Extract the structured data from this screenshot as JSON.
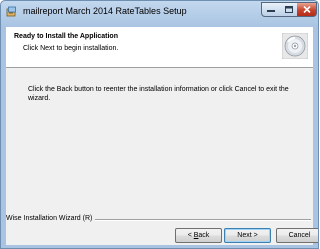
{
  "window": {
    "title": "mailreport March 2014 RateTables Setup",
    "minimize_glyph": "▁",
    "maximize_glyph": "□",
    "close_glyph": "✕"
  },
  "header": {
    "title": "Ready to Install the Application",
    "subtitle": "Click Next to begin installation."
  },
  "body": {
    "message": "Click the Back button to reenter the installation information or click Cancel to exit the wizard."
  },
  "footer": {
    "brand": "Wise Installation Wizard (R)"
  },
  "buttons": {
    "back_prefix": "< ",
    "back_mnemonic": "B",
    "back_rest": "ack",
    "next": "Next >",
    "cancel": "Cancel"
  },
  "colors": {
    "close_button": "#c7432c",
    "title_gradient": "#a9c4e2"
  },
  "icons": {
    "app": "installer-app-icon",
    "header": "cd-disc-icon"
  }
}
